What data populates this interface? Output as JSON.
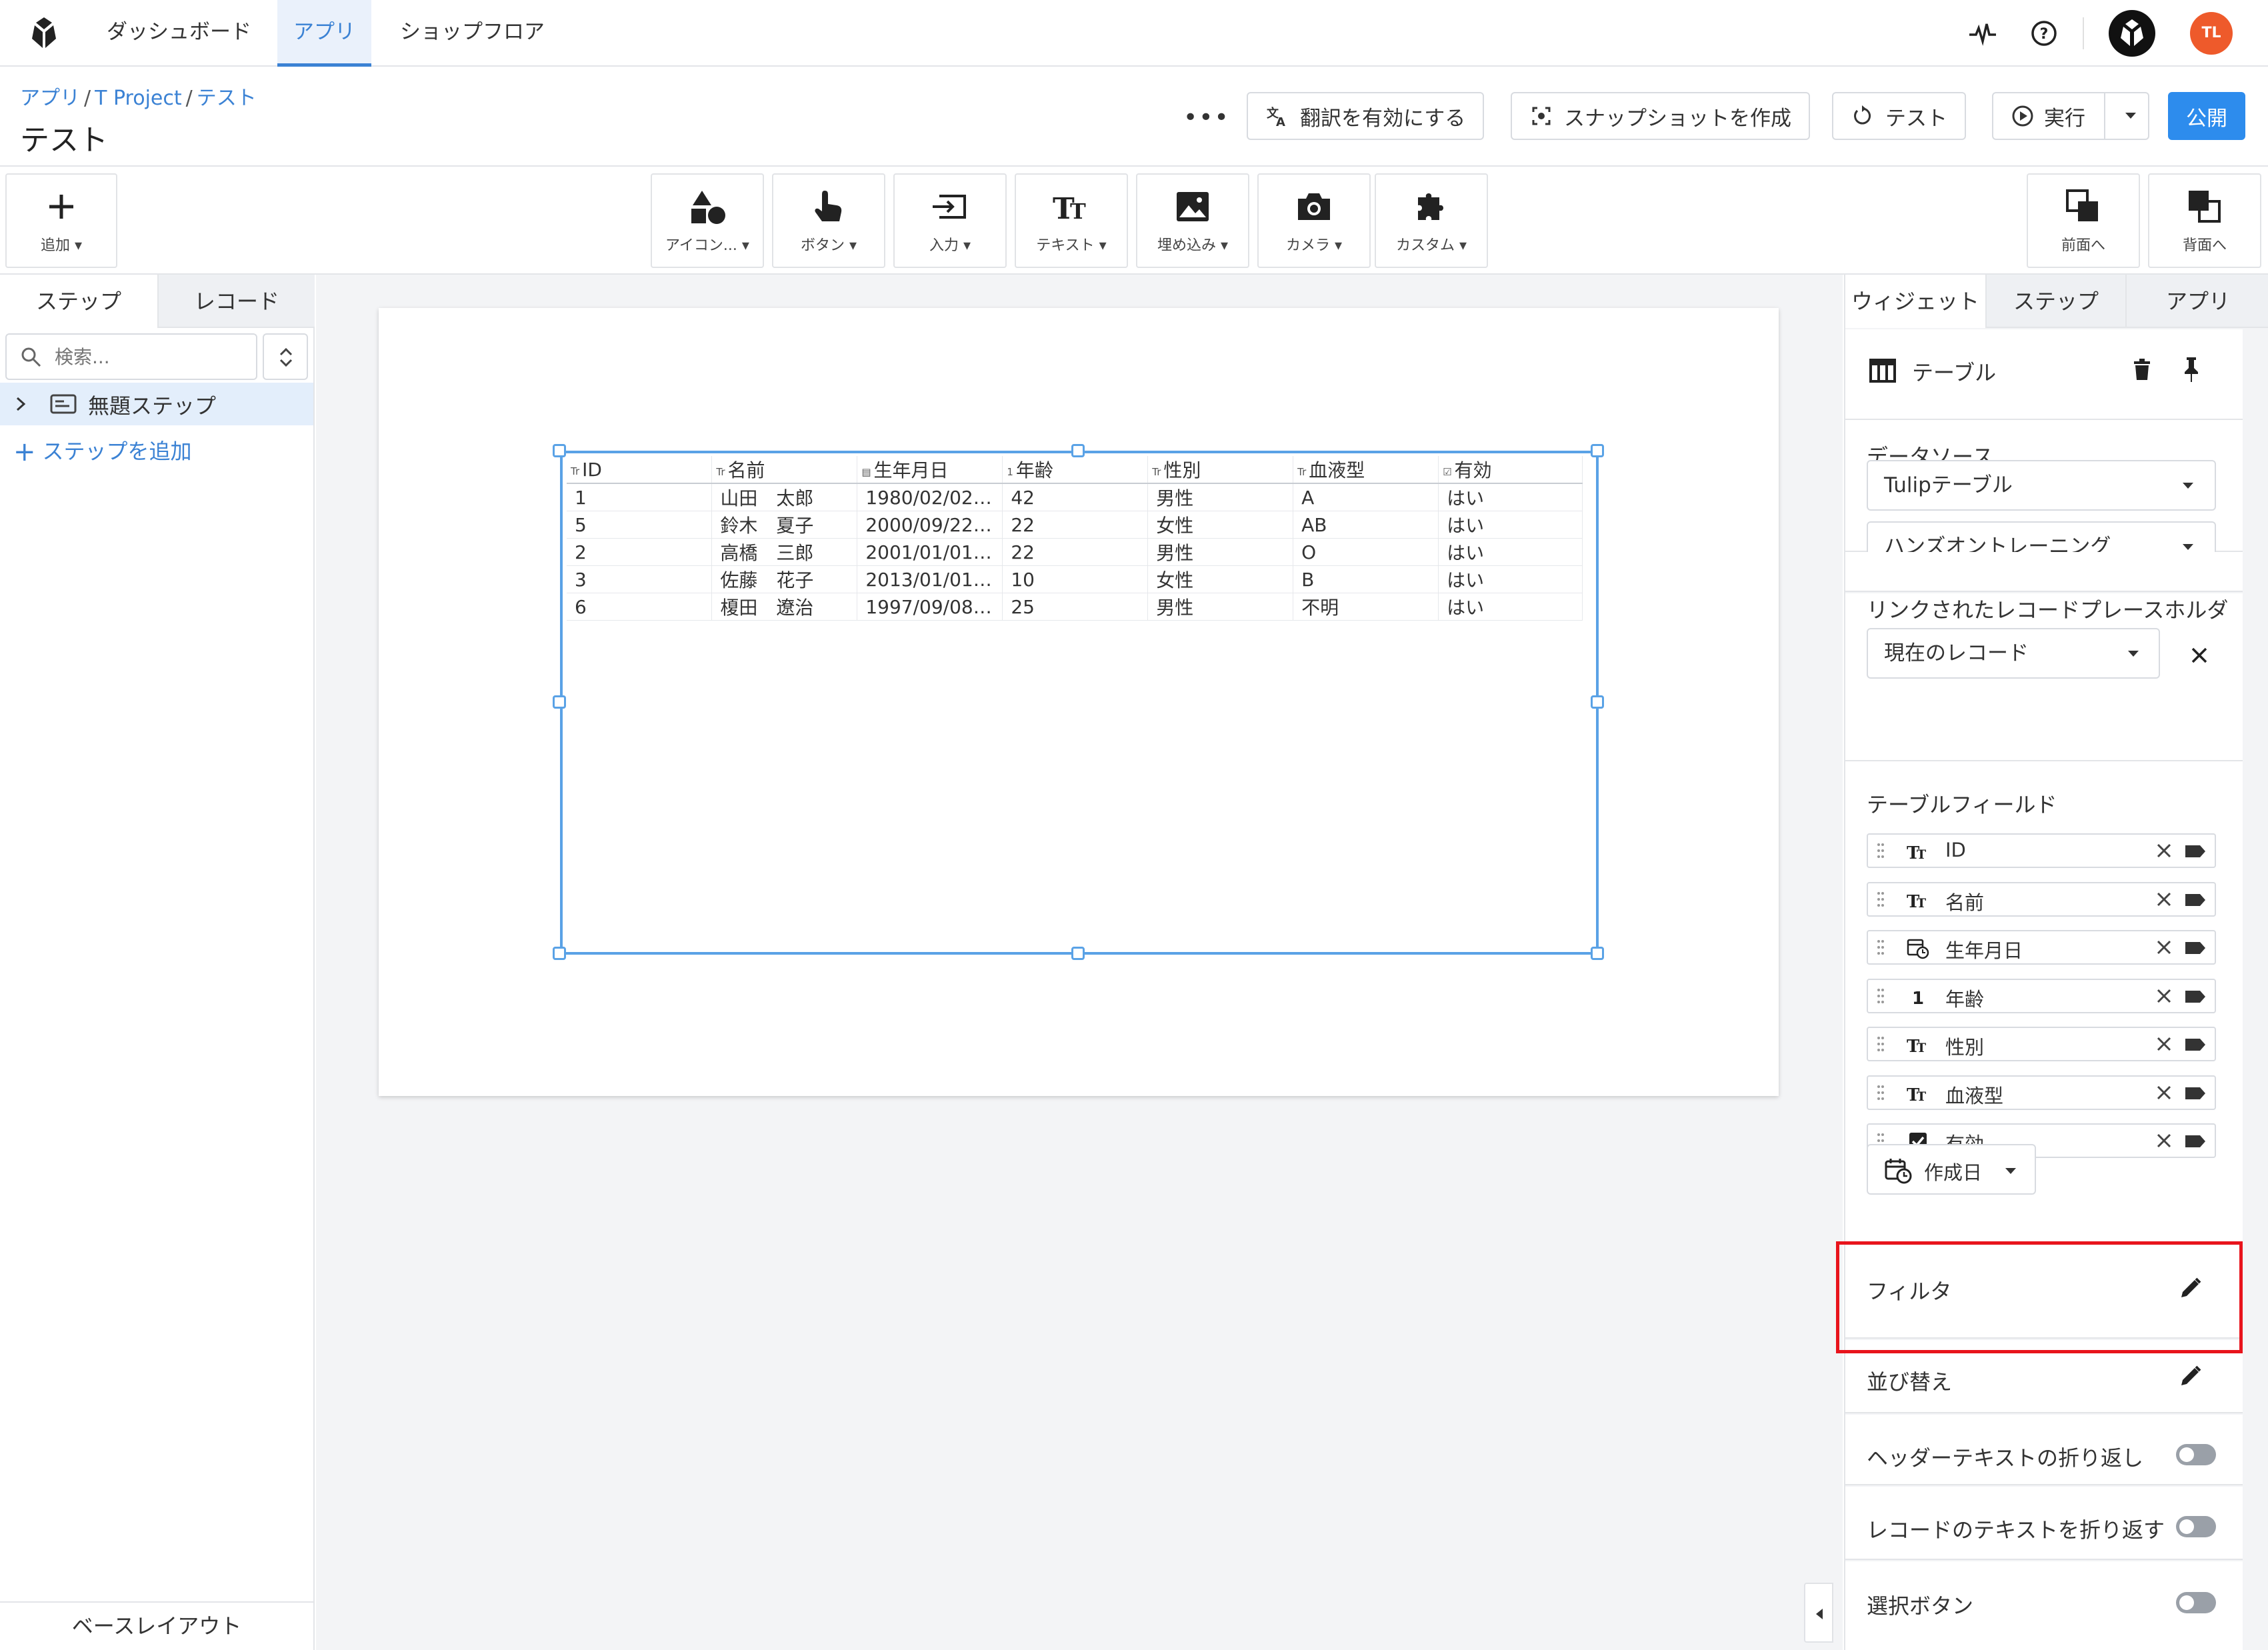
{
  "nav": {
    "tabs": [
      "ダッシュボード",
      "アプリ",
      "ショップフロア"
    ],
    "active_tab": "アプリ",
    "user_initials": "TL"
  },
  "header": {
    "breadcrumb": [
      "アプリ",
      "T Project",
      "テスト"
    ],
    "title": "テスト",
    "more": "•••",
    "translate_label": "翻訳を有効にする",
    "snapshot_label": "スナップショットを作成",
    "test_label": "テスト",
    "run_label": "実行",
    "publish_label": "公開"
  },
  "toolbar": {
    "add_label": "追加",
    "tools": [
      "アイコン...",
      "ボタン",
      "入力",
      "テキスト",
      "埋め込み",
      "カメラ",
      "カスタム"
    ],
    "bring_forward": "前面へ",
    "send_back": "背面へ"
  },
  "left_panel": {
    "tabs": [
      "ステップ",
      "レコード"
    ],
    "active_tab": "ステップ",
    "search_placeholder": "検索...",
    "steps": [
      "無題ステップ"
    ],
    "add_step": "ステップを追加",
    "base_layout": "ベースレイアウト"
  },
  "table_widget": {
    "columns": [
      {
        "icon": "Tr",
        "name": "ID"
      },
      {
        "icon": "Tr",
        "name": "名前"
      },
      {
        "icon": "cal",
        "name": "生年月日"
      },
      {
        "icon": "1",
        "name": "年齢"
      },
      {
        "icon": "Tr",
        "name": "性別"
      },
      {
        "icon": "Tr",
        "name": "血液型"
      },
      {
        "icon": "chk",
        "name": "有効"
      }
    ],
    "rows": [
      [
        "1",
        "山田　太郎",
        "1980/02/02…",
        "42",
        "男性",
        "A",
        "はい"
      ],
      [
        "5",
        "鈴木　夏子",
        "2000/09/22…",
        "22",
        "女性",
        "AB",
        "はい"
      ],
      [
        "2",
        "高橋　三郎",
        "2001/01/01…",
        "22",
        "男性",
        "O",
        "はい"
      ],
      [
        "3",
        "佐藤　花子",
        "2013/01/01…",
        "10",
        "女性",
        "B",
        "はい"
      ],
      [
        "6",
        "榎田　遼治",
        "1997/09/08…",
        "25",
        "男性",
        "不明",
        "はい"
      ]
    ]
  },
  "right_panel": {
    "tabs": [
      "ウィジェット",
      "ステップ",
      "アプリ"
    ],
    "active_tab": "ウィジェット",
    "widget_name": "テーブル",
    "datasource_title": "データソース",
    "datasource_type": "Tulipテーブル",
    "datasource_table": "ハンズオントレーニング",
    "linked_title": "リンクされたレコードプレースホルダ",
    "linked_value": "現在のレコード",
    "fields_title": "テーブルフィールド",
    "fields": [
      {
        "type": "text",
        "name": "ID"
      },
      {
        "type": "text",
        "name": "名前"
      },
      {
        "type": "datetime",
        "name": "生年月日"
      },
      {
        "type": "number",
        "name": "年齢"
      },
      {
        "type": "text",
        "name": "性別"
      },
      {
        "type": "text",
        "name": "血液型"
      },
      {
        "type": "boolean",
        "name": "有効"
      }
    ],
    "add_field_label": "作成日",
    "filter_label": "フィルタ",
    "sort_label": "並び替え",
    "wrap_header_label": "ヘッダーテキストの折り返し",
    "wrap_record_label": "レコードのテキストを折り返す",
    "select_button_label": "選択ボタン"
  },
  "colors": {
    "accent": "#3b82d4",
    "publish": "#2d8ced",
    "highlight": "#e8141c",
    "avatar": "#ee5a2b"
  }
}
